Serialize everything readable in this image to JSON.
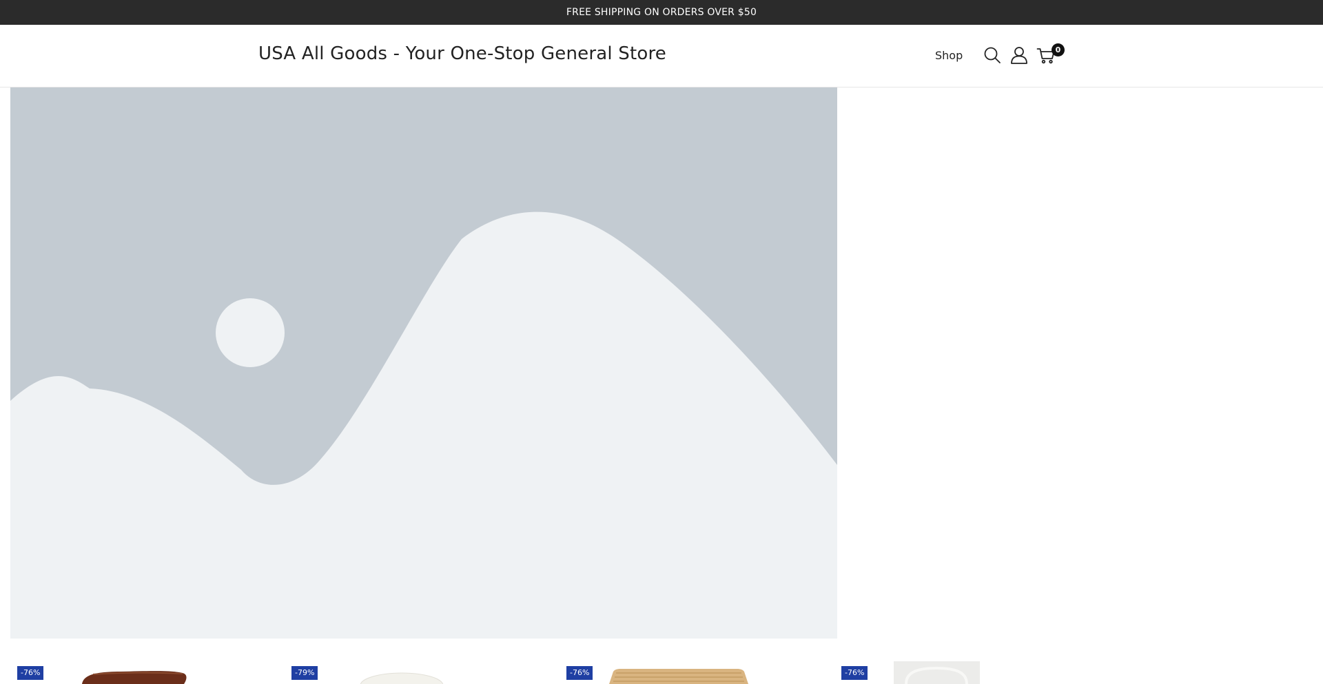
{
  "announcement": {
    "text": "FREE SHIPPING ON ORDERS OVER $50"
  },
  "header": {
    "site_title": "USA All Goods - Your One-Stop General Store",
    "nav": {
      "shop_label": "Shop"
    },
    "icons": {
      "search": "search-icon",
      "account": "user-icon",
      "cart": "cart-icon"
    },
    "cart_count": "0"
  },
  "hero": {
    "image": "image-placeholder",
    "colors": {
      "sky": "#c3cbd2",
      "hills": "#eff2f4"
    }
  },
  "products": [
    {
      "discount": "-76%",
      "thumb": "brown-wooden-board"
    },
    {
      "discount": "-79%",
      "thumb": "white-round-item"
    },
    {
      "discount": "-76%",
      "thumb": "woven-basket"
    },
    {
      "discount": "-76%",
      "thumb": "white-tray"
    }
  ],
  "colors": {
    "announcement_bg": "#2b2b2b",
    "badge_bg": "#1f3fa3"
  }
}
